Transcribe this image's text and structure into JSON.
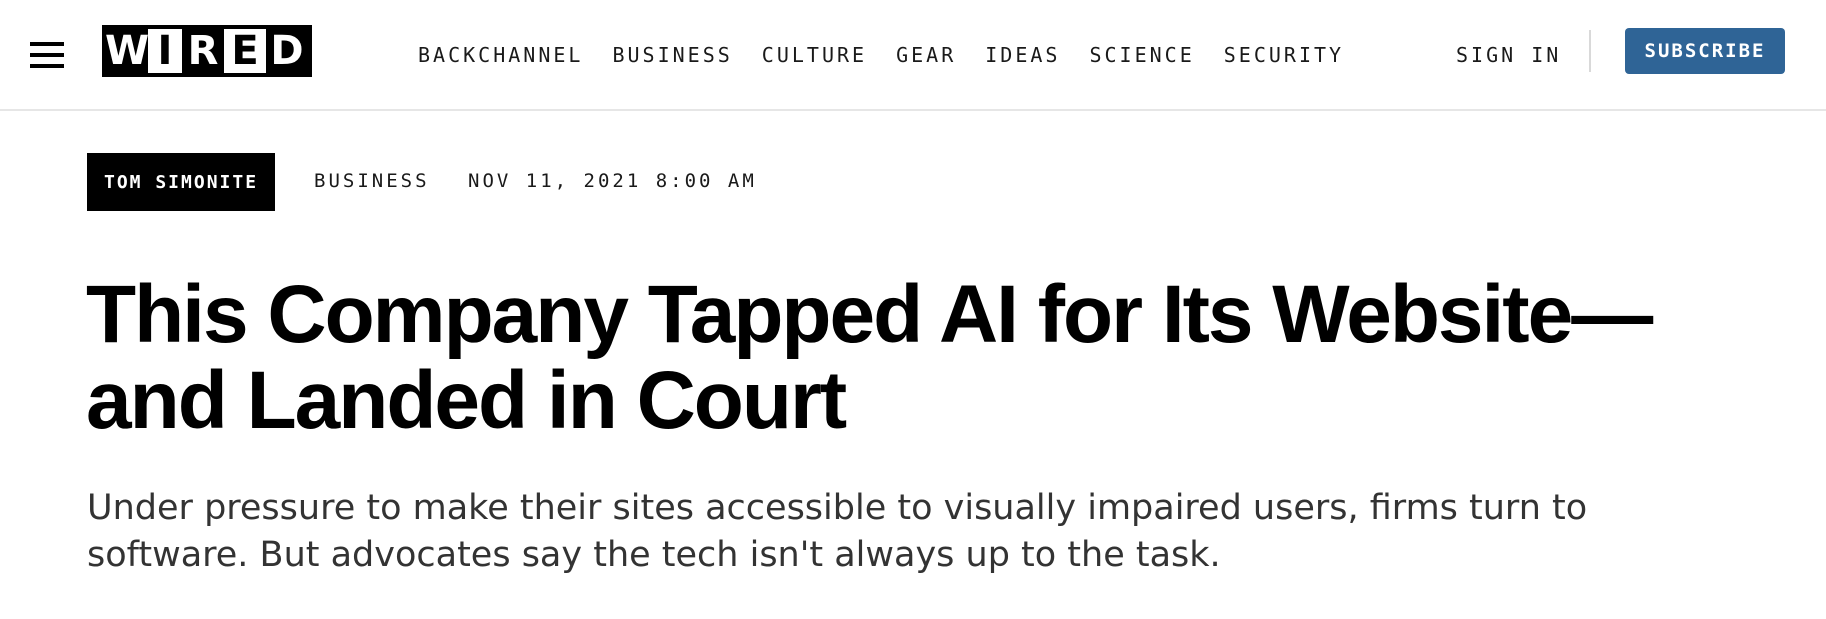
{
  "header": {
    "logo_letters": [
      "W",
      "I",
      "R",
      "E",
      "D"
    ],
    "nav": [
      "BACKCHANNEL",
      "BUSINESS",
      "CULTURE",
      "GEAR",
      "IDEAS",
      "SCIENCE",
      "SECURITY"
    ],
    "sign_in_label": "SIGN IN",
    "subscribe_label": "SUBSCRIBE",
    "subscribe_color": "#2f6496"
  },
  "article": {
    "author": "TOM SIMONITE",
    "section": "BUSINESS",
    "date": "NOV 11, 2021 8:00 AM",
    "headline": "This Company Tapped AI for Its Website—and Landed in Court",
    "dek": "Under pressure to make their sites accessible to visually impaired users, firms turn to software. But advocates say the tech isn't always up to the task."
  },
  "icons": {
    "menu": "hamburger-menu-icon"
  }
}
